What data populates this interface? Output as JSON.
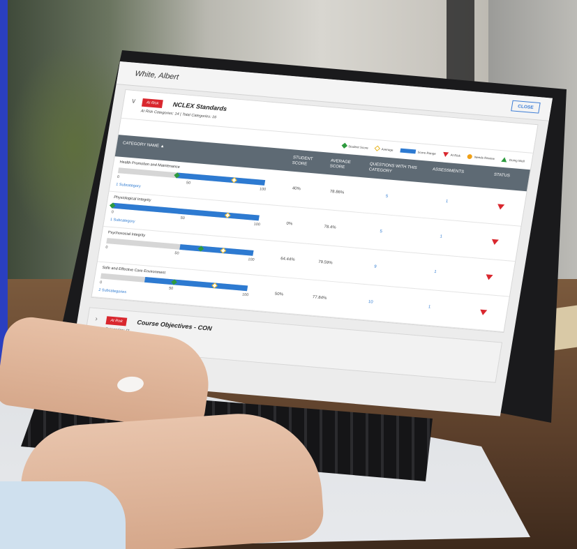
{
  "student": {
    "name": "White, Albert"
  },
  "close_label": "CLOSE",
  "nclex": {
    "badge": "At Risk",
    "title": "NCLEX Standards",
    "subtitle": "At Risk Categories: 14 | Total Categories: 16"
  },
  "legend": [
    {
      "icon": "green-diamond",
      "label": "Student Score"
    },
    {
      "icon": "yellow-diamond-outline",
      "label": "Average"
    },
    {
      "icon": "blue-bar",
      "label": "Score Range"
    },
    {
      "icon": "red-triangle",
      "label": "At Risk"
    },
    {
      "icon": "orange-dot",
      "label": "Needs Review"
    },
    {
      "icon": "green-triangle",
      "label": "Doing Well"
    }
  ],
  "columns": {
    "category": "CATEGORY NAME ▲",
    "student_score": "STUDENT SCORE",
    "average_score": "AVERAGE SCORE",
    "questions": "QUESTIONS WITH THIS CATEGORY",
    "assessments": "ASSESSMENTS",
    "status": "STATUS"
  },
  "rows": [
    {
      "name": "Health Promotion and Maintenance",
      "ticks": [
        "0",
        "50",
        "100"
      ],
      "subcategory": "1 Subcategory",
      "range": [
        40,
        100
      ],
      "student": 40,
      "average": 78.86,
      "student_score": "40%",
      "average_score": "78.86%",
      "questions": "5",
      "assessments": "1",
      "status": "at-risk"
    },
    {
      "name": "Physiological Integrity",
      "ticks": [
        "0",
        "50",
        "100"
      ],
      "subcategory": "1 Subcategory",
      "range": [
        0,
        100
      ],
      "student": 0,
      "average": 78.4,
      "student_score": "0%",
      "average_score": "78.4%",
      "questions": "5",
      "assessments": "1",
      "status": "at-risk"
    },
    {
      "name": "Psychosocial Integrity",
      "ticks": [
        "0",
        "50",
        "100"
      ],
      "subcategory": "",
      "range": [
        50,
        100
      ],
      "student": 64.44,
      "average": 79.59,
      "student_score": "64.44%",
      "average_score": "79.59%",
      "questions": "9",
      "assessments": "1",
      "status": "at-risk"
    },
    {
      "name": "Safe and Effective Care Environment",
      "ticks": [
        "0",
        "50",
        "100"
      ],
      "subcategory": "2 Subcategories",
      "range": [
        30,
        100
      ],
      "student": 50,
      "average": 77.84,
      "student_score": "50%",
      "average_score": "77.84%",
      "questions": "10",
      "assessments": "1",
      "status": "at-risk"
    }
  ],
  "course": {
    "badge": "At Risk",
    "title": "Course Objectives - CON",
    "subtitle": "Categories: 11"
  },
  "colors": {
    "at_risk": "#d9272e",
    "range": "#2d7ad1",
    "student": "#2e9b3e",
    "average": "#e8b622",
    "header": "#5e6a74"
  }
}
